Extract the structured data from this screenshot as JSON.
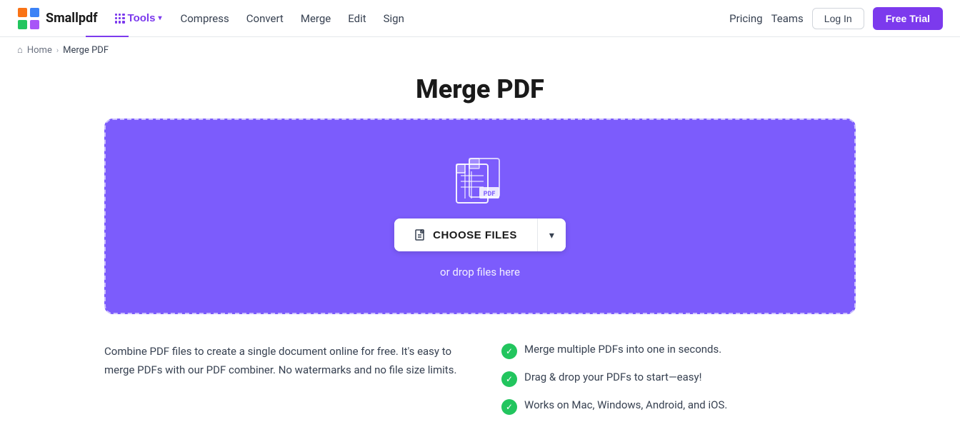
{
  "header": {
    "logo_text": "Smallpdf",
    "tools_label": "Tools",
    "nav": [
      {
        "label": "Compress",
        "key": "compress"
      },
      {
        "label": "Convert",
        "key": "convert"
      },
      {
        "label": "Merge",
        "key": "merge"
      },
      {
        "label": "Edit",
        "key": "edit"
      },
      {
        "label": "Sign",
        "key": "sign"
      }
    ],
    "right": {
      "pricing": "Pricing",
      "teams": "Teams",
      "login": "Log In",
      "free_trial": "Free Trial"
    }
  },
  "breadcrumb": {
    "home": "Home",
    "current": "Merge PDF"
  },
  "page": {
    "title": "Merge PDF",
    "dropzone": {
      "choose_files": "CHOOSE FILES",
      "drop_text": "or drop files here"
    },
    "description": "Combine PDF files to create a single document online for free. It's easy to merge PDFs with our PDF combiner. No watermarks and no file size limits.",
    "features": [
      "Merge multiple PDFs into one in seconds.",
      "Drag & drop your PDFs to start—easy!",
      "Works on Mac, Windows, Android, and iOS."
    ]
  },
  "icons": {
    "grid": "grid-icon",
    "chevron_down": "▾",
    "home_icon": "⌂",
    "breadcrumb_sep": "›",
    "check": "✓",
    "file_icon": "📄",
    "chevron_dropdown": "▾"
  },
  "colors": {
    "accent": "#7c3aed",
    "dropzone_bg": "#7c5cfc",
    "success": "#22c55e"
  }
}
